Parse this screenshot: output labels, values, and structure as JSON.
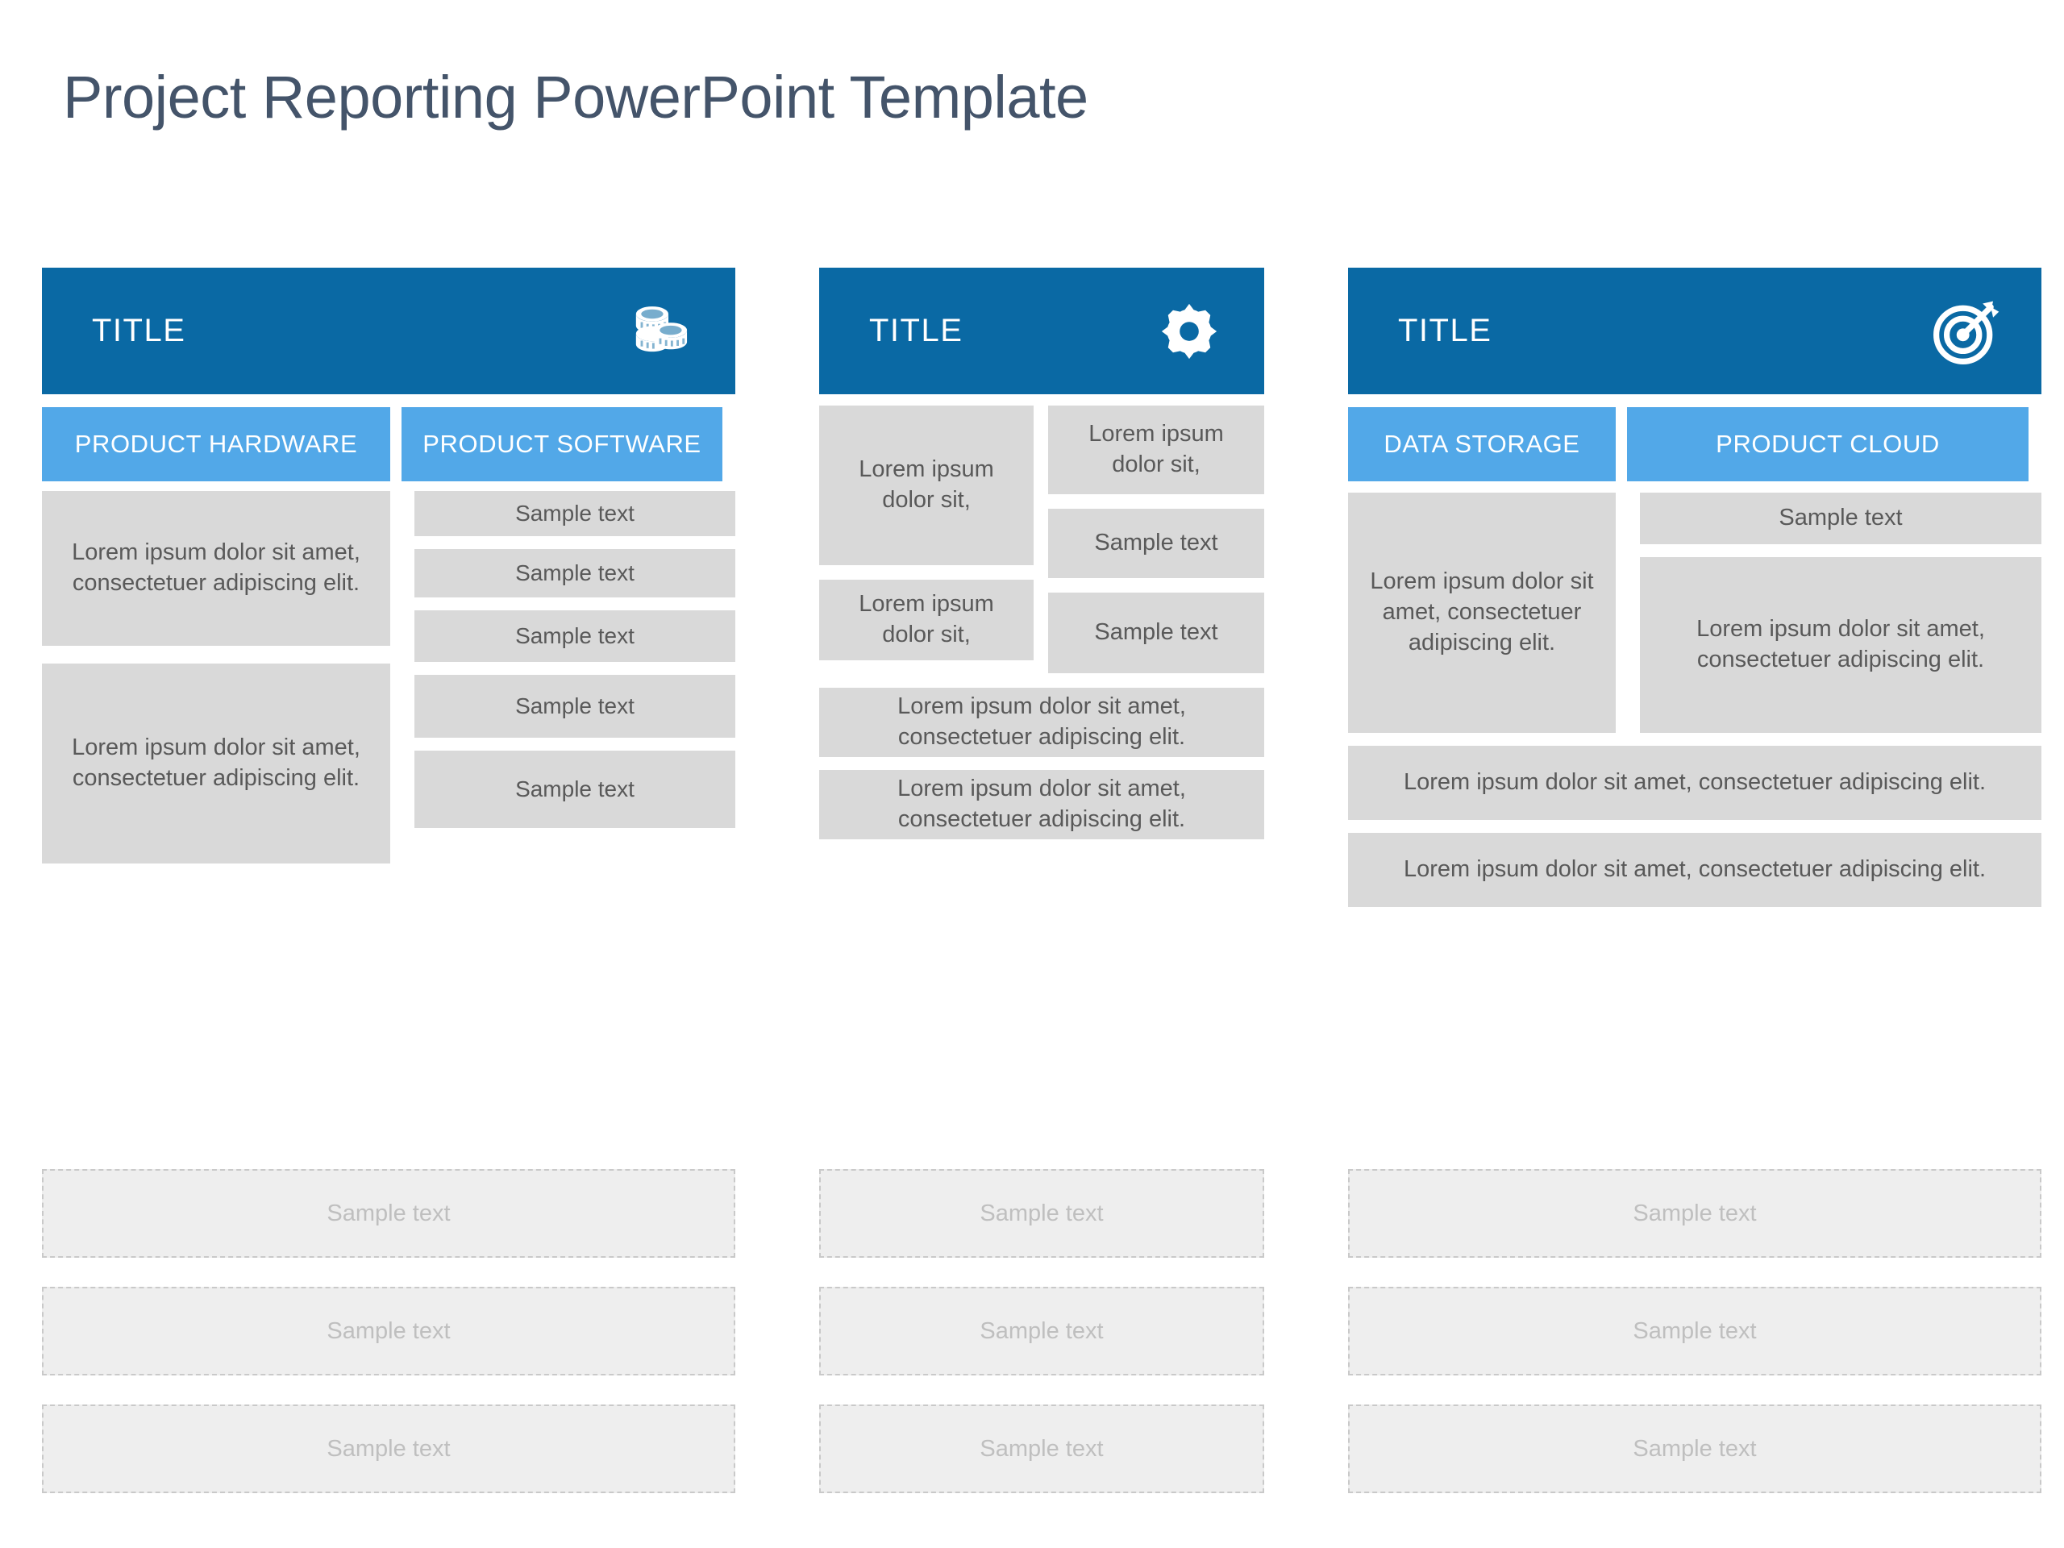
{
  "slide": {
    "title": "Project Reporting PowerPoint Template"
  },
  "theme": {
    "dark_blue": "#0a69a4",
    "light_blue": "#52a8e8",
    "block_grey": "#d9d9d9",
    "placeholder_grey": "#eeeeee",
    "title_color": "#44546a",
    "body_text": "#595959"
  },
  "columns": [
    {
      "header": {
        "label": "TITLE",
        "icon": "coins-stack-icon"
      },
      "subheads": [
        {
          "label": "PRODUCT HARDWARE"
        },
        {
          "label": "PRODUCT SOFTWARE"
        }
      ],
      "left_blocks": [
        {
          "text": "Lorem ipsum dolor sit amet, consectetuer adipiscing elit."
        },
        {
          "text": "Lorem ipsum dolor sit amet, consectetuer adipiscing elit."
        }
      ],
      "right_blocks": [
        {
          "text": "Sample text"
        },
        {
          "text": "Sample text"
        },
        {
          "text": "Sample text"
        },
        {
          "text": "Sample text"
        },
        {
          "text": "Sample text"
        }
      ],
      "placeholders": [
        {
          "text": "Sample text"
        },
        {
          "text": "Sample text"
        },
        {
          "text": "Sample text"
        }
      ]
    },
    {
      "header": {
        "label": "TITLE",
        "icon": "gear-icon"
      },
      "subheads": [],
      "grid_left": [
        {
          "text": "Lorem ipsum dolor sit,"
        },
        {
          "text": "Lorem ipsum dolor sit,"
        }
      ],
      "grid_right": [
        {
          "text": "Lorem ipsum dolor sit,"
        },
        {
          "text": "Sample text"
        },
        {
          "text": "Sample text"
        }
      ],
      "rows": [
        {
          "text": "Lorem ipsum dolor sit amet, consectetuer adipiscing elit."
        },
        {
          "text": "Lorem ipsum dolor sit amet, consectetuer adipiscing elit."
        }
      ],
      "placeholders": [
        {
          "text": "Sample text"
        },
        {
          "text": "Sample text"
        },
        {
          "text": "Sample text"
        }
      ]
    },
    {
      "header": {
        "label": "TITLE",
        "icon": "target-arrow-icon"
      },
      "subheads": [
        {
          "label": "DATA STORAGE"
        },
        {
          "label": "PRODUCT CLOUD"
        }
      ],
      "grid_left": [
        {
          "text": "Lorem ipsum dolor sit amet, consectetuer adipiscing elit."
        }
      ],
      "grid_right": [
        {
          "text": "Sample text"
        },
        {
          "text": "Lorem ipsum dolor sit amet, consectetuer adipiscing elit."
        }
      ],
      "rows": [
        {
          "text": "Lorem ipsum dolor sit amet, consectetuer adipiscing elit."
        },
        {
          "text": "Lorem ipsum dolor sit amet, consectetuer adipiscing elit."
        }
      ],
      "placeholders": [
        {
          "text": "Sample text"
        },
        {
          "text": "Sample text"
        },
        {
          "text": "Sample text"
        }
      ]
    }
  ]
}
